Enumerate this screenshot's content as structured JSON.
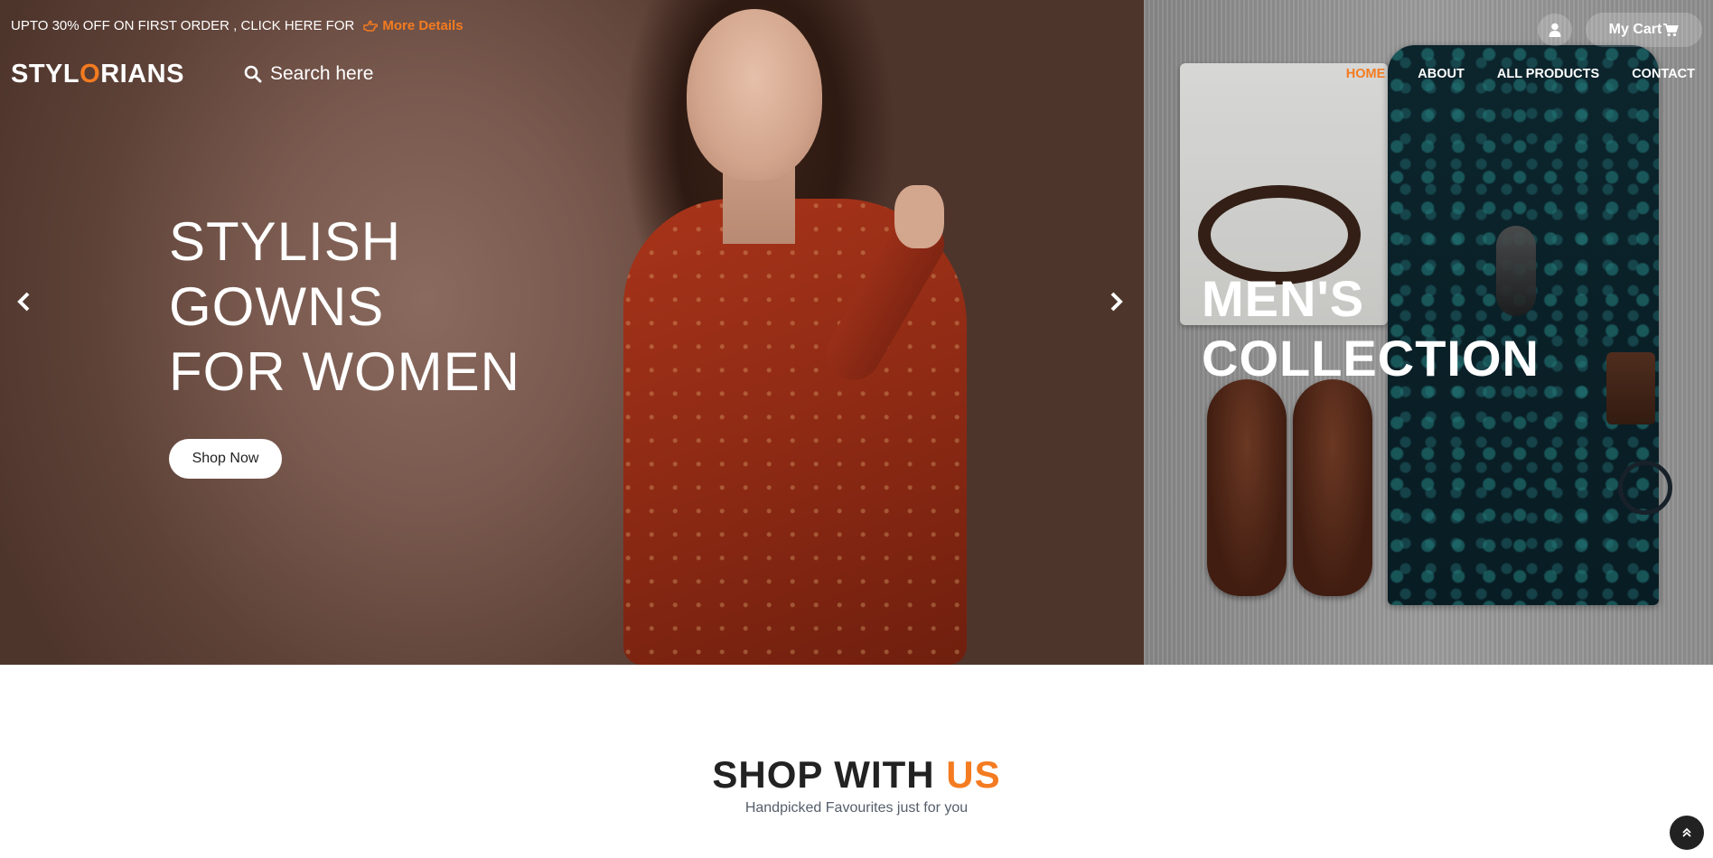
{
  "promo": {
    "text": "UPTO 30% OFF ON FIRST ORDER , CLICK HERE FOR",
    "link_label": "More Details",
    "icon": "hand-point-right-icon"
  },
  "logo": {
    "part1": "STYL",
    "accent": "O",
    "part2": "RIANS"
  },
  "search": {
    "placeholder": "Search here",
    "icon": "search-icon"
  },
  "nav": {
    "items": [
      {
        "label": "HOME",
        "active": true
      },
      {
        "label": "ABOUT",
        "active": false
      },
      {
        "label": "ALL PRODUCTS",
        "active": false
      },
      {
        "label": "CONTACT",
        "active": false
      }
    ]
  },
  "header_actions": {
    "user_icon": "user-icon",
    "cart_label": "My Cart",
    "cart_icon": "shopping-cart-icon"
  },
  "hero": {
    "slide_title_lines": [
      "STYLISH",
      "GOWNS",
      "FOR WOMEN"
    ],
    "cta_label": "Shop Now",
    "side_title_lines": [
      "MEN'S",
      "COLLECTION"
    ]
  },
  "section": {
    "title_main": "SHOP WITH",
    "title_accent": "US",
    "subtitle": "Handpicked Favourites just for you"
  },
  "colors": {
    "accent": "#f47b20",
    "dark": "#222222",
    "white": "#ffffff"
  }
}
